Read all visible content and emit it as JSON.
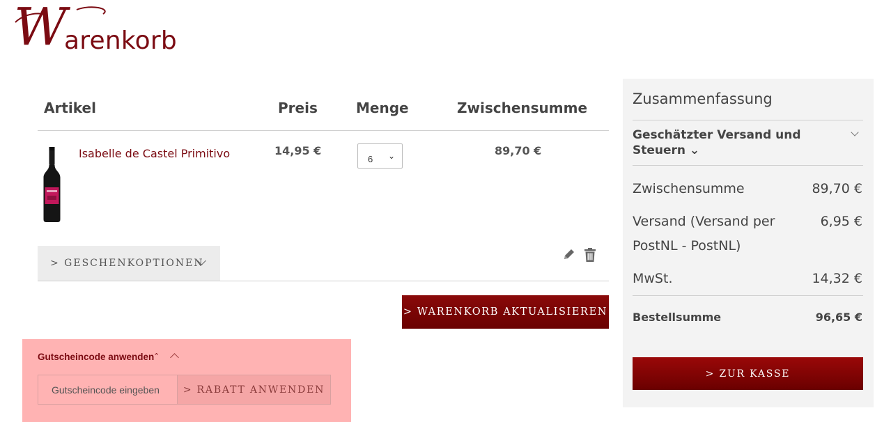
{
  "page": {
    "title_initial": "W",
    "title_rest": "arenkorb"
  },
  "table": {
    "headers": {
      "item": "Artikel",
      "price": "Preis",
      "qty": "Menge",
      "subtotal": "Zwischensumme"
    },
    "rows": [
      {
        "name": "Isabelle de Castel Primitivo",
        "price": "14,95 €",
        "qty": "6",
        "subtotal": "89,70 €"
      }
    ]
  },
  "actions": {
    "gift_options": "> GESCHENKOPTIONEN",
    "update_cart": "> WARENKORB AKTUALISIEREN"
  },
  "coupon": {
    "title": "Gutscheincode anwenden",
    "caret": "⌃",
    "placeholder": "Gutscheincode eingeben",
    "apply": "> RABATT ANWENDEN"
  },
  "summary": {
    "title": "Zusammenfassung",
    "shipping_estimate": "Geschätzter Versand und Steuern ⌄",
    "subtotal_label": "Zwischensumme",
    "subtotal_value": "89,70 €",
    "shipping_label": "Versand (Versand per PostNL - PostNL)",
    "shipping_value": "6,95 €",
    "tax_label": "MwSt.",
    "tax_value": "14,32 €",
    "total_label": "Bestellsumme",
    "total_value": "96,65 €",
    "checkout": "> ZUR KASSE"
  },
  "icons": {
    "edit": "pencil-icon",
    "delete": "trash-icon"
  },
  "colors": {
    "brand": "#7b0b12",
    "button": "#7a0000",
    "coupon_bg": "#ffb3b3",
    "summary_bg": "#f3f3f3"
  }
}
